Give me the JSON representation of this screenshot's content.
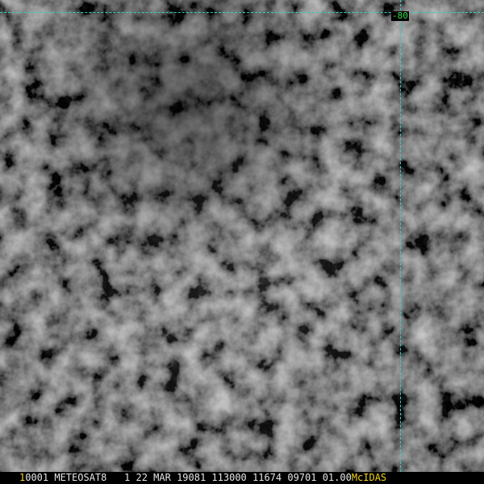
{
  "image": {
    "description_colors": {
      "grid": "#2fd0c8",
      "grid_label": "#36e04a",
      "frame_number": "#f2d21a",
      "status_text": "#e6e6e6",
      "brand": "#f2d21a"
    }
  },
  "grid": {
    "longitude_label": "-80"
  },
  "status_bar": {
    "frame_number": "1",
    "info": "0001 METEOSAT8   1 22 MAR 19081 113000 11674 09701 01.00",
    "brand": "McIDAS"
  }
}
